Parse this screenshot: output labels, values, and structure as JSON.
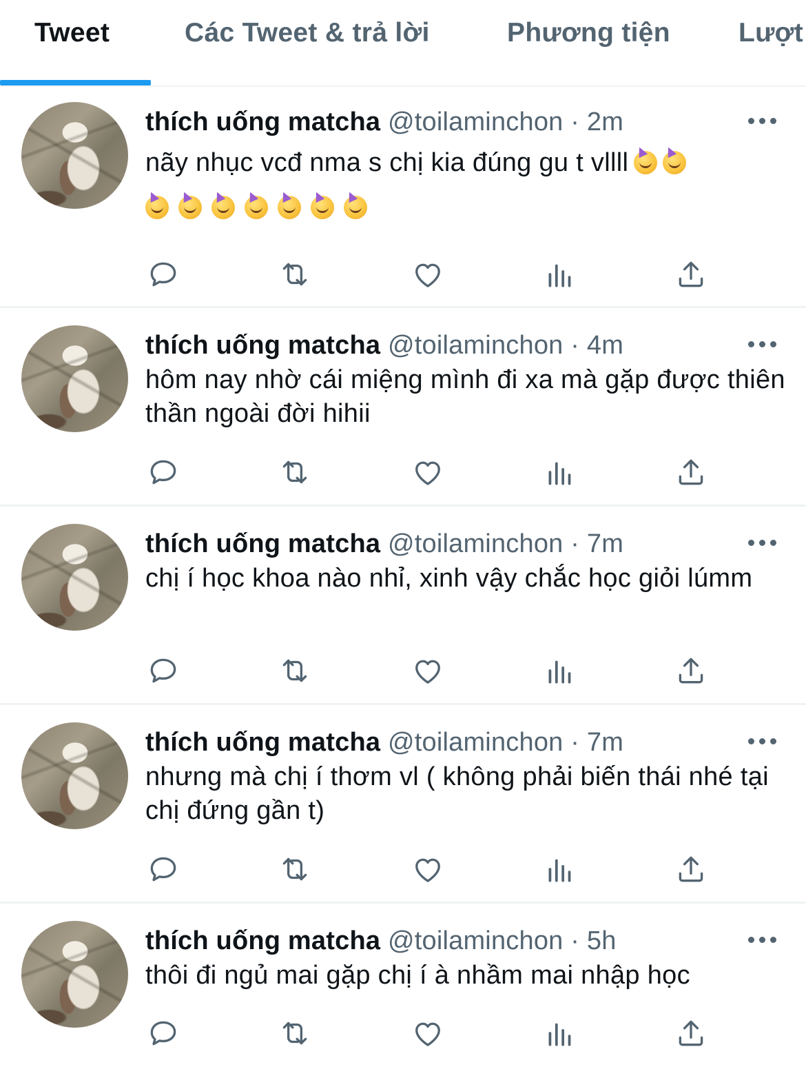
{
  "tabs": [
    {
      "label": "Tweet",
      "active": true
    },
    {
      "label": "Các Tweet & trả lời",
      "active": false
    },
    {
      "label": "Phương tiện",
      "active": false
    },
    {
      "label": "Lượt",
      "active": false
    }
  ],
  "tweets": [
    {
      "name": "thích uống matcha",
      "handle": "@toilaminchon",
      "separator": "·",
      "time": "2m",
      "text": "nãy nhục vcđ nma s chị kia đúng gu t vllll",
      "emoji_inline_count": 2,
      "emoji_row_count": 7,
      "emoji_name": "partying-face"
    },
    {
      "name": "thích uống matcha",
      "handle": "@toilaminchon",
      "separator": "·",
      "time": "4m",
      "text": "hôm nay nhờ cái miệng mình đi xa mà gặp được thiên thần ngoài đời hihii"
    },
    {
      "name": "thích uống matcha",
      "handle": "@toilaminchon",
      "separator": "·",
      "time": "7m",
      "text": "chị í học khoa nào nhỉ, xinh vậy chắc học giỏi lúmm"
    },
    {
      "name": "thích uống matcha",
      "handle": "@toilaminchon",
      "separator": "·",
      "time": "7m",
      "text": "nhưng mà chị í thơm vl ( không phải biến thái nhé tại chị đứng gần t)"
    },
    {
      "name": "thích uống matcha",
      "handle": "@toilaminchon",
      "separator": "·",
      "time": "5h",
      "text": "thôi đi ngủ mai gặp chị í à nhầm mai nhập học"
    }
  ],
  "action_icons": [
    "reply-icon",
    "retweet-icon",
    "like-icon",
    "analytics-icon",
    "share-icon"
  ],
  "colors": {
    "accent": "#1d9bf0",
    "secondary_text": "#536471",
    "primary_text": "#0f1419",
    "divider": "#eff3f4"
  }
}
